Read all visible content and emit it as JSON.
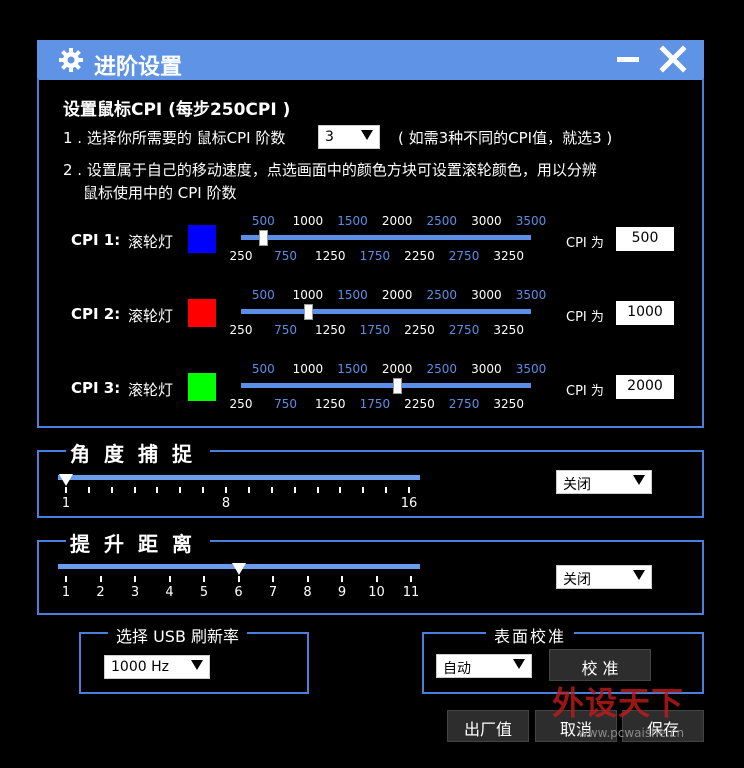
{
  "window": {
    "title": "进阶设置",
    "title_icon": "gear-icon",
    "minimize_icon": "minimize-icon",
    "close_icon": "close-icon"
  },
  "cpi": {
    "heading": "设置鼠标CPI (每步250CPI )",
    "step1_prefix": "1 . 选择你所需要的 鼠标CPI 阶数",
    "levels_value": "3",
    "step1_suffix": "( 如需3种不同的CPI值，就选3 )",
    "step2_line1": "2 . 设置属于自己的移动速度，点选画面中的颜色方块可设置滚轮颜色，用以分辨",
    "step2_line2": "鼠标使用中的 CPI 阶数",
    "scale_top": [
      "500",
      "1000",
      "1500",
      "2000",
      "2500",
      "3000",
      "3500"
    ],
    "scale_bottom": [
      "250",
      "750",
      "1250",
      "1750",
      "2250",
      "2750",
      "3250"
    ],
    "cpi_is_label": "CPI 为",
    "rows": [
      {
        "label": "CPI 1:",
        "wheel": "滚轮灯",
        "color": "#0000ff",
        "value": "500"
      },
      {
        "label": "CPI 2:",
        "wheel": "滚轮灯",
        "color": "#ff0000",
        "value": "1000"
      },
      {
        "label": "CPI 3:",
        "wheel": "滚轮灯",
        "color": "#00ff00",
        "value": "2000"
      }
    ]
  },
  "angle_snap": {
    "title": "角度捕捉",
    "slider_value": 1,
    "labels": [
      "1",
      "8",
      "16"
    ],
    "dropdown": "关闭"
  },
  "lift_distance": {
    "title": "提升距离",
    "slider_value": 6,
    "labels": [
      "1",
      "2",
      "3",
      "4",
      "5",
      "6",
      "7",
      "8",
      "9",
      "10",
      "11"
    ],
    "dropdown": "关闭"
  },
  "usb": {
    "title": "选择 USB 刷新率",
    "value": "1000 Hz"
  },
  "surface": {
    "title": "表面校准",
    "mode": "自动",
    "calibrate_label": "校 准"
  },
  "buttons": {
    "factory": "出厂值",
    "cancel": "取消",
    "save": "保存"
  },
  "watermark": {
    "text": "外设天下",
    "url": "www.pcwaishe.cn"
  }
}
